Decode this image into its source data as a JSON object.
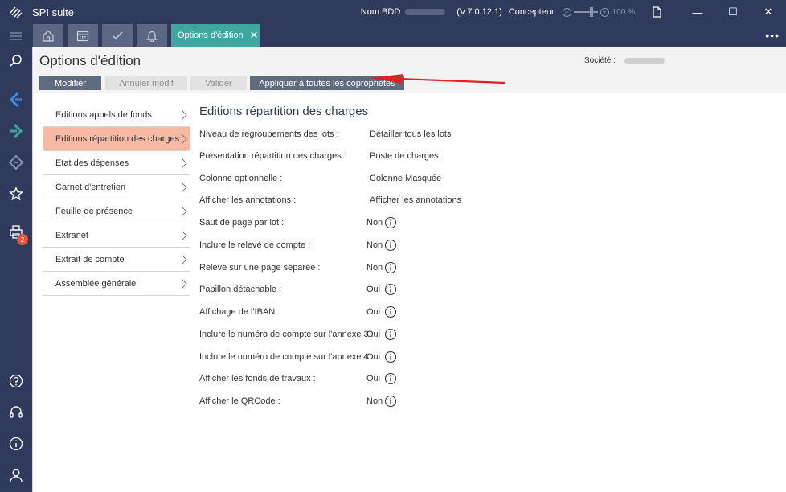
{
  "window": {
    "title": "SPI suite",
    "db_label": "Nom BDD",
    "version": "(V.7.0.12.1)",
    "role": "Concepteur",
    "zoom": "100 %",
    "minimize": "—",
    "maximize": "☐",
    "close": "✕"
  },
  "tabs": {
    "active_label": "Options d'édition",
    "close_glyph": "✕",
    "more_glyph": "•••"
  },
  "page": {
    "title": "Options d'édition",
    "societe_label": "Société :"
  },
  "toolbar": {
    "modifier": "Modifier",
    "annuler": "Annuler modif",
    "valider": "Valider",
    "appliquer": "Appliquer à toutes les copropriétés"
  },
  "menu": [
    "Editions appels de fonds",
    "Editions répartition des charges",
    "Etat des dépenses",
    "Carnet d'entretien",
    "Feuille de présence",
    "Extranet",
    "Extrait de compte",
    "Assemblée générale"
  ],
  "menu_active_index": 1,
  "section": {
    "title": "Editions répartition des charges",
    "rows": [
      {
        "label": "Niveau de regroupements des lots :",
        "value": "Détailler tous les lots"
      },
      {
        "label": "Présentation répartition des charges :",
        "value": "Poste de charges"
      },
      {
        "label": "Colonne optionnelle :",
        "value": "Colonne Masquée"
      },
      {
        "label": "Afficher les annotations :",
        "value": "Afficher les annotations"
      },
      {
        "label": "Saut de page par lot :",
        "value": "Non"
      },
      {
        "label": "Inclure le relevé de compte :",
        "value": "Non"
      },
      {
        "label": "Relevé sur une page séparée :",
        "value": "Non"
      },
      {
        "label": "Papillon détachable :",
        "value": "Oui"
      },
      {
        "label": "Affichage de l'IBAN :",
        "value": "Oui"
      },
      {
        "label": "Inclure le numéro de compte sur l'annexe 3 :",
        "value": "Oui"
      },
      {
        "label": "Inclure le numéro de compte sur l'annexe 4 :",
        "value": "Oui"
      },
      {
        "label": "Afficher les fonds de travaux :",
        "value": "Oui"
      },
      {
        "label": "Afficher le QRCode :",
        "value": "Non"
      }
    ]
  },
  "sidebar": {
    "badge_count": "2"
  },
  "colors": {
    "navy": "#2f3a5c",
    "teal": "#3fa6a0",
    "active_menu": "#f7b9a3",
    "button": "#616b80",
    "arrow": "#e02020"
  },
  "icons": [
    "app-logo-icon",
    "menu-icon",
    "search-icon",
    "arrow-left-icon",
    "arrow-right-icon",
    "diamond-icon",
    "star-icon",
    "printer-icon",
    "help-icon",
    "headset-icon",
    "info-icon",
    "user-icon",
    "home-icon",
    "calendar-icon",
    "check-icon",
    "bell-icon",
    "document-icon",
    "chevron-right-icon"
  ]
}
